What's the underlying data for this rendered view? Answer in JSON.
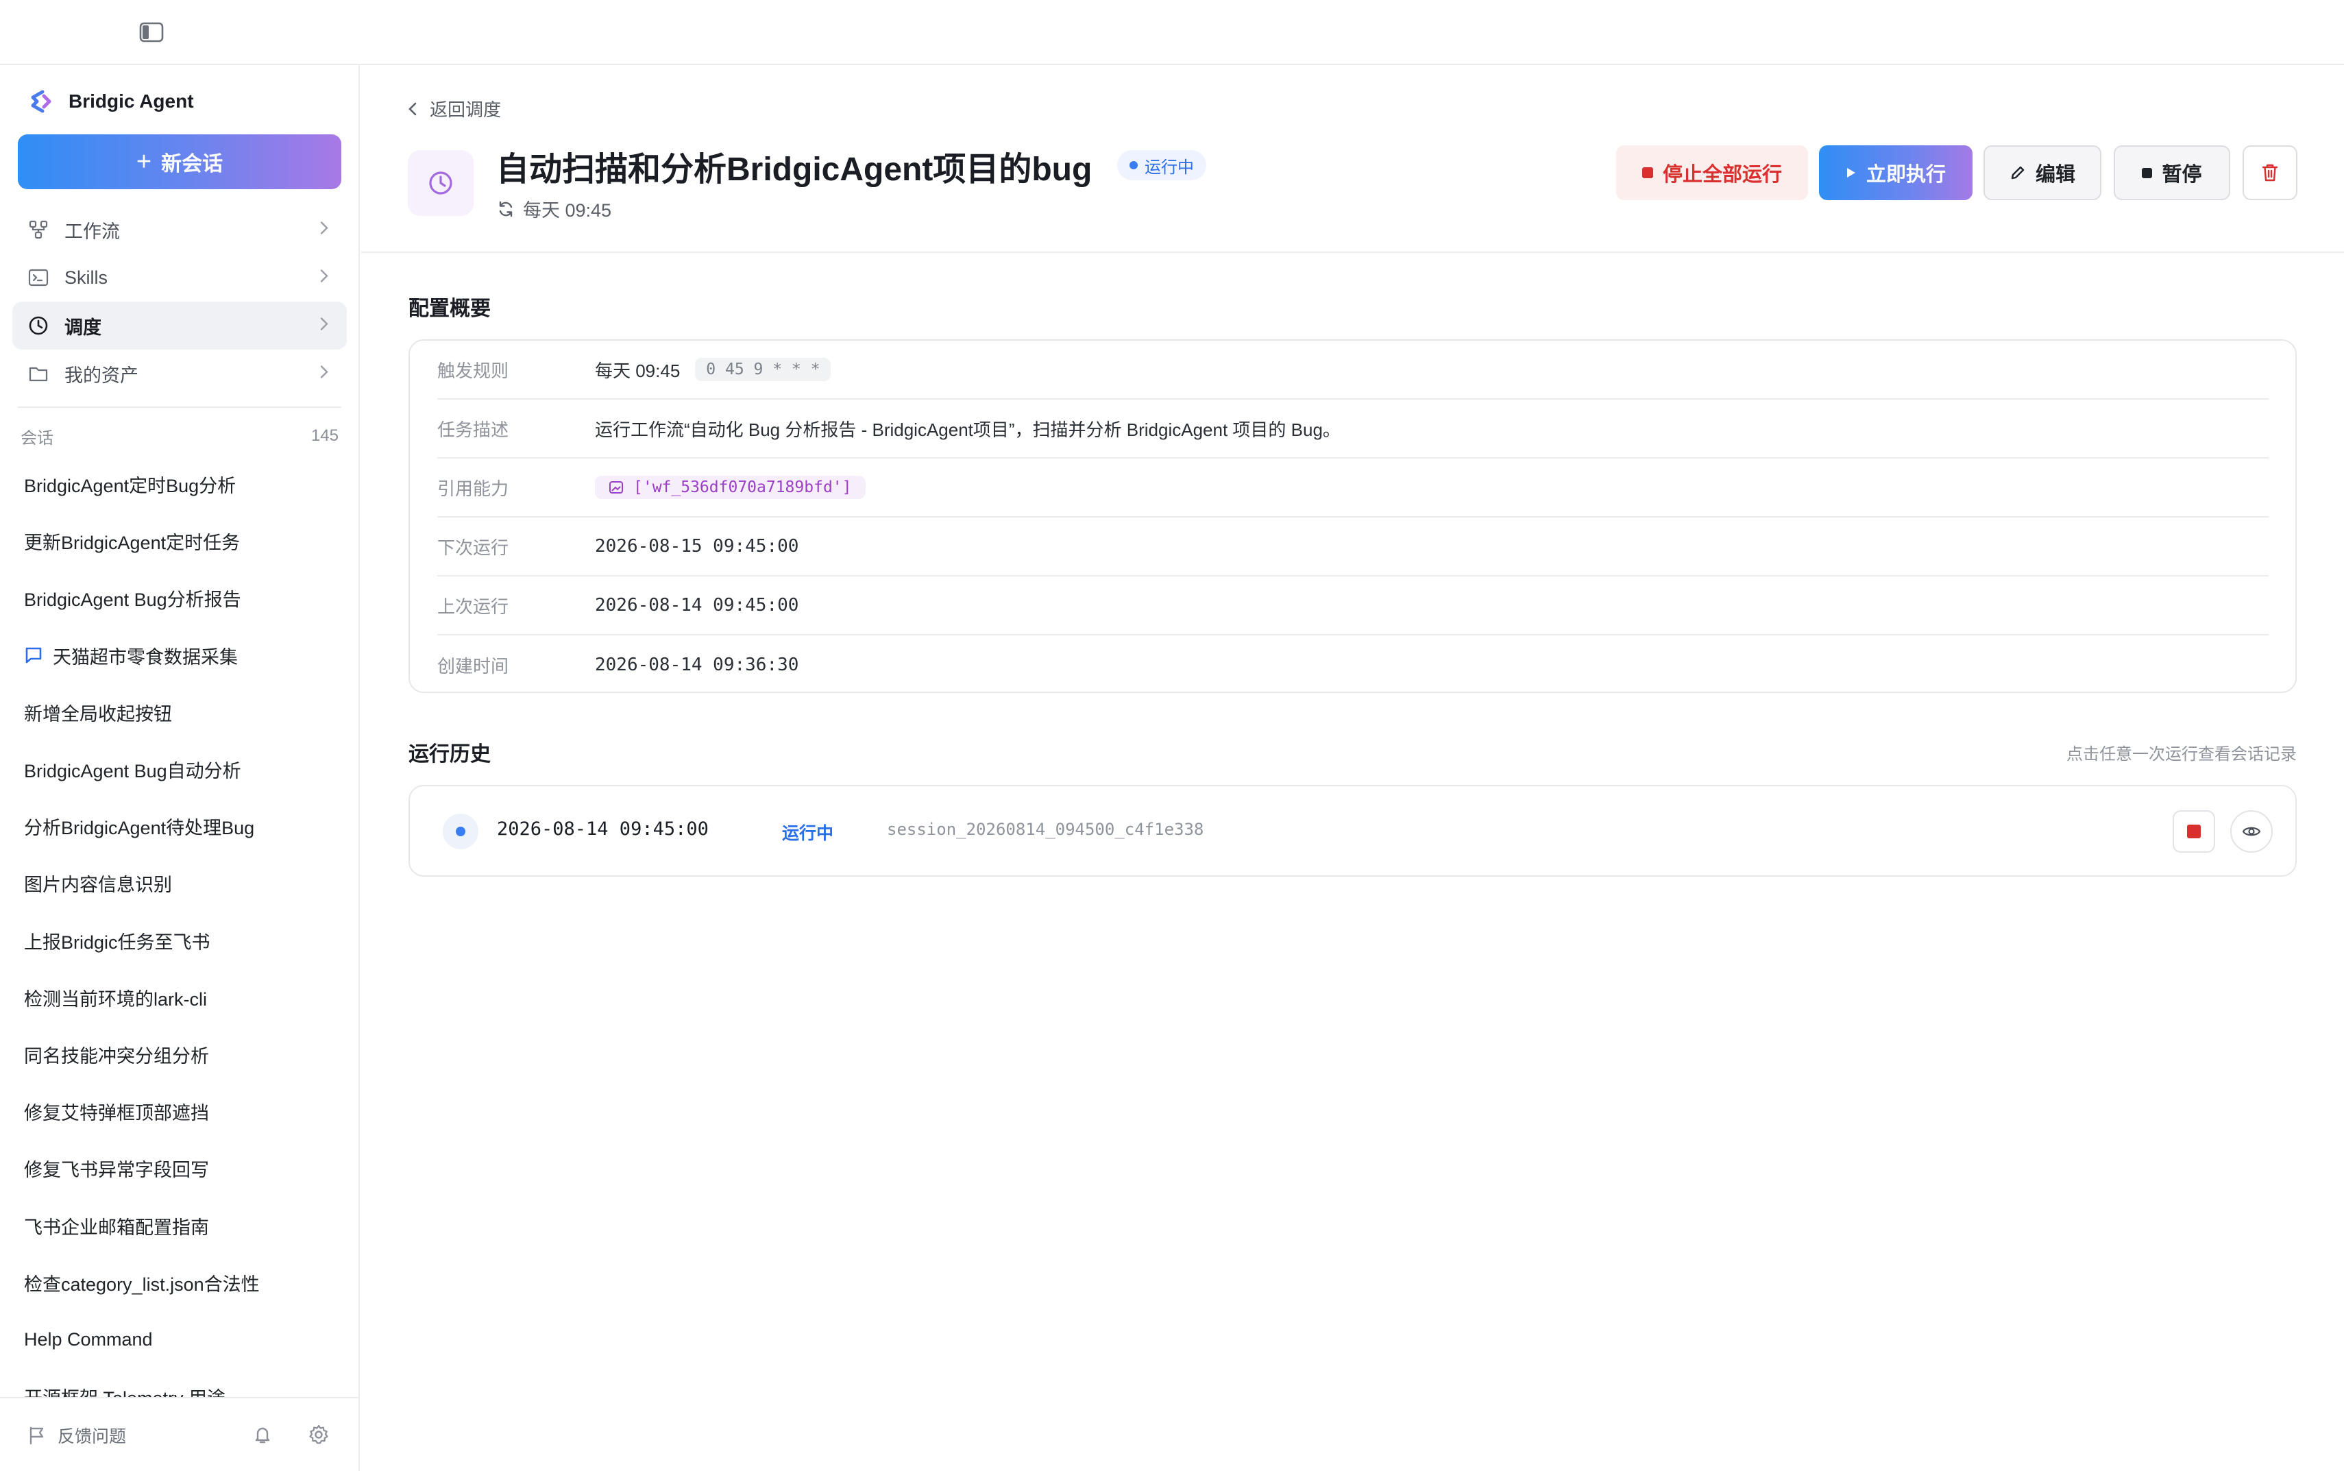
{
  "app": {
    "brand_name": "Bridgic Agent",
    "new_chat_label": "新会话"
  },
  "colors": {
    "accent_blue": "#2f8ef5",
    "accent_purple": "#a879e6",
    "danger": "#d92f2f",
    "status_blue": "#2a6ee8"
  },
  "nav": {
    "items": [
      {
        "label": "工作流",
        "icon": "workflow-icon",
        "active": false
      },
      {
        "label": "Skills",
        "icon": "terminal-icon",
        "active": false
      },
      {
        "label": "调度",
        "icon": "clock-icon",
        "active": true
      },
      {
        "label": "我的资产",
        "icon": "folder-icon",
        "active": false
      }
    ]
  },
  "sessions": {
    "label": "会话",
    "count": "145",
    "items": [
      "BridgicAgent定时Bug分析",
      "更新BridgicAgent定时任务",
      "BridgicAgent Bug分析报告",
      "天猫超市零食数据采集",
      "新增全局收起按钮",
      "BridgicAgent Bug自动分析",
      "分析BridgicAgent待处理Bug",
      "图片内容信息识别",
      "上报Bridgic任务至飞书",
      "检测当前环境的lark-cli",
      "同名技能冲突分组分析",
      "修复艾特弹框顶部遮挡",
      "修复飞书异常字段回写",
      "飞书企业邮箱配置指南",
      "检查category_list.json合法性",
      "Help Command",
      "开源框架 Telemetry 用途"
    ]
  },
  "footer": {
    "feedback_label": "反馈问题"
  },
  "task": {
    "back_label": "返回调度",
    "title": "自动扫描和分析BridgicAgent项目的bug",
    "status": "运行中",
    "schedule": "每天 09:45"
  },
  "actions": {
    "stop_all": "停止全部运行",
    "run_now": "立即执行",
    "edit": "编辑",
    "pause": "暂停"
  },
  "config": {
    "title": "配置概要",
    "rows": [
      {
        "label": "触发规则",
        "value": "每天 09:45",
        "cron": "0 45 9 * * *"
      },
      {
        "label": "任务描述",
        "value": "运行工作流“自动化 Bug 分析报告 - BridgicAgent项目”，扫描并分析 BridgicAgent 项目的 Bug。"
      },
      {
        "label": "引用能力",
        "value": "['wf_536df070a7189bfd']"
      },
      {
        "label": "下次运行",
        "value": "2026-08-15 09:45:00"
      },
      {
        "label": "上次运行",
        "value": "2026-08-14 09:45:00"
      },
      {
        "label": "创建时间",
        "value": "2026-08-14 09:36:30"
      }
    ]
  },
  "history": {
    "title": "运行历史",
    "hint": "点击任意一次运行查看会话记录",
    "runs": [
      {
        "time": "2026-08-14 09:45:00",
        "status": "运行中",
        "session": "session_20260814_094500_c4f1e338"
      }
    ]
  }
}
